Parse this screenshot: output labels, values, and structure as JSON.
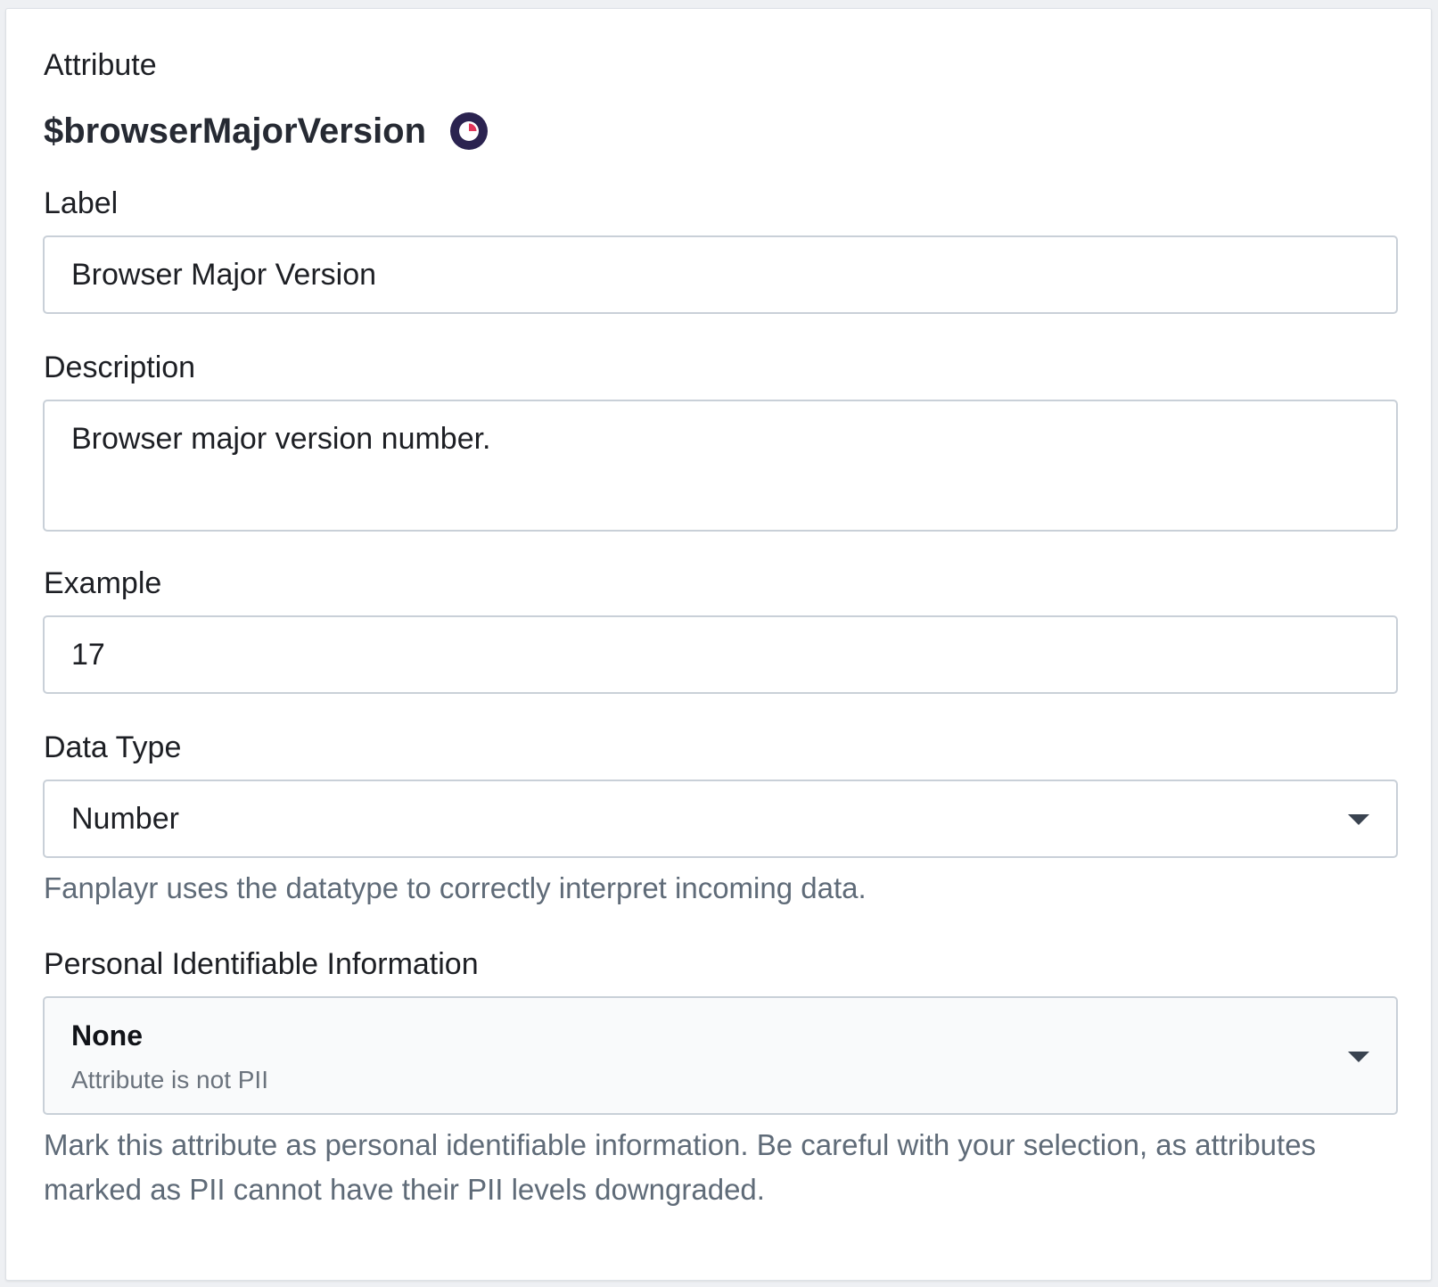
{
  "attribute": {
    "section_label": "Attribute",
    "name": "$browserMajorVersion",
    "icon": "pie-chart-icon",
    "icon_colors": {
      "circle": "#2b2350",
      "accent": "#e2365a"
    }
  },
  "label": {
    "section_label": "Label",
    "value": "Browser Major Version"
  },
  "description": {
    "section_label": "Description",
    "value": "Browser major version number."
  },
  "example": {
    "section_label": "Example",
    "value": "17"
  },
  "data_type": {
    "section_label": "Data Type",
    "selected": "Number",
    "help": "Fanplayr uses the datatype to correctly interpret incoming data."
  },
  "pii": {
    "section_label": "Personal Identifiable Information",
    "selected_title": "None",
    "selected_subtitle": "Attribute is not PII",
    "help": "Mark this attribute as personal identifiable information. Be careful with your selection, as attributes marked as PII cannot have their PII levels downgraded."
  }
}
